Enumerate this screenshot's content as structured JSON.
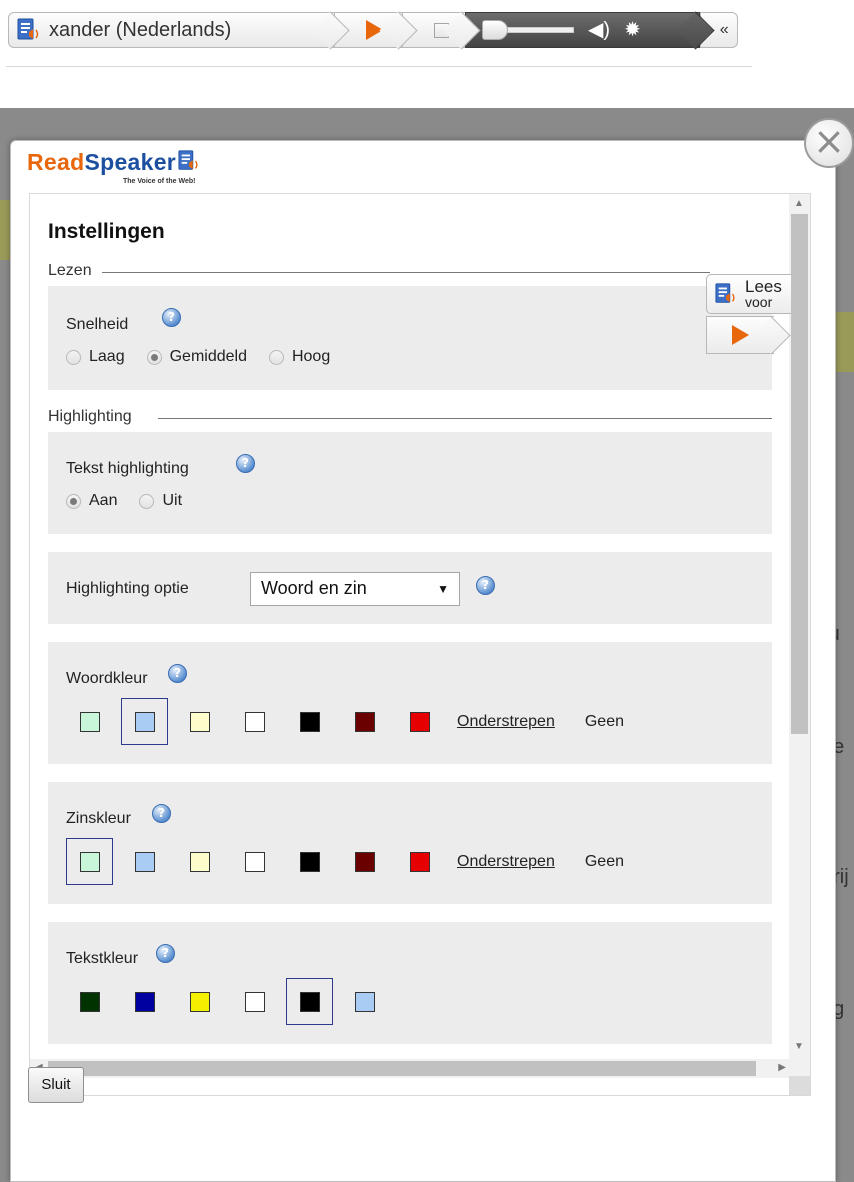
{
  "toolbar": {
    "voice_label": "xander (Nederlands)",
    "collapse_symbol": "«",
    "icons": [
      "readspeaker-icon",
      "play-icon",
      "stop-icon",
      "volume-icon",
      "settings-icon"
    ],
    "colors": {
      "play": "#e8660c",
      "dark_segment": "#555555"
    }
  },
  "background_fragments": [
    "ru",
    "ee",
    "grij",
    "ug"
  ],
  "dialog": {
    "logo": {
      "read": "Read",
      "speaker": "Speaker",
      "tagline": "The Voice of the Web!"
    },
    "title": "Instellingen",
    "lees_voor": {
      "line1": "Lees",
      "line2": "voor"
    },
    "close_symbol": "×",
    "sections": {
      "lezen": {
        "legend": "Lezen",
        "snelheid": {
          "label": "Snelheid",
          "options": [
            "Laag",
            "Gemiddeld",
            "Hoog"
          ],
          "selected": "Gemiddeld"
        }
      },
      "highlighting": {
        "legend": "Highlighting",
        "tekst_highlighting": {
          "label": "Tekst highlighting",
          "options": [
            "Aan",
            "Uit"
          ],
          "selected": "Aan"
        },
        "highlighting_optie": {
          "label": "Highlighting optie",
          "value": "Woord en zin"
        },
        "woordkleur": {
          "label": "Woordkleur",
          "colors": [
            "#c9f5d8",
            "#a9ccf5",
            "#fdfccb",
            "#ffffff",
            "#000000",
            "#6b0000",
            "#e60000"
          ],
          "selected_index": 1,
          "underline_label": "Onderstrepen",
          "none_label": "Geen"
        },
        "zinskleur": {
          "label": "Zinskleur",
          "colors": [
            "#c9f5d8",
            "#a9ccf5",
            "#fdfccb",
            "#ffffff",
            "#000000",
            "#6b0000",
            "#e60000"
          ],
          "selected_index": 0,
          "underline_label": "Onderstrepen",
          "none_label": "Geen"
        },
        "tekstkleur": {
          "label": "Tekstkleur",
          "colors": [
            "#003300",
            "#0000a0",
            "#f5f000",
            "#ffffff",
            "#000000",
            "#a9ccf5"
          ],
          "selected_index": 4
        }
      }
    },
    "sluit_label": "Sluit"
  }
}
